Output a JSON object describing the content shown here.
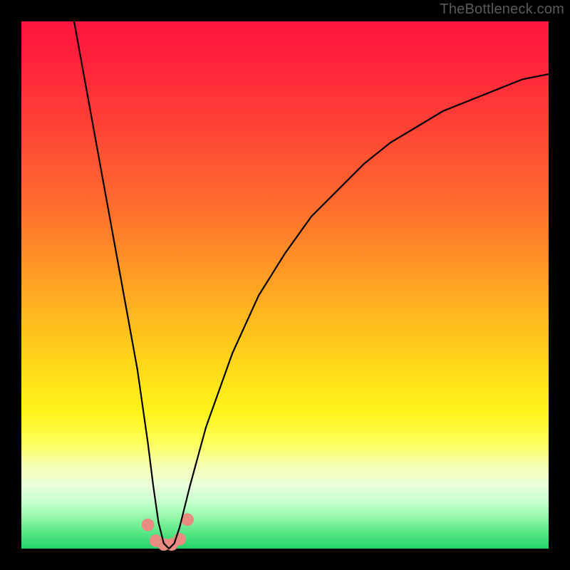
{
  "watermark": "TheBottleneck.com",
  "chart_data": {
    "type": "line",
    "title": "",
    "xlabel": "",
    "ylabel": "",
    "xlim": [
      0,
      100
    ],
    "ylim": [
      0,
      100
    ],
    "grid": false,
    "note": "No axis ticks or numeric labels are rendered; values are estimated from pixel positions on a 0–100 normalized axis.",
    "series": [
      {
        "name": "curve",
        "color": "#000000",
        "x": [
          10,
          12,
          14,
          16,
          18,
          20,
          22,
          24,
          25,
          26,
          27,
          28,
          29,
          30,
          32,
          35,
          40,
          45,
          50,
          55,
          60,
          65,
          70,
          75,
          80,
          85,
          90,
          95,
          100
        ],
        "y": [
          100,
          89,
          78,
          67,
          56,
          45,
          34,
          20,
          12,
          5,
          1,
          0,
          1,
          4,
          12,
          23,
          37,
          48,
          56,
          63,
          68,
          73,
          77,
          80,
          83,
          85,
          87,
          89,
          90
        ]
      }
    ],
    "markers": {
      "name": "bottom-cluster",
      "color": "#e98b81",
      "points": [
        {
          "x": 24.0,
          "y": 4.5
        },
        {
          "x": 25.5,
          "y": 1.5
        },
        {
          "x": 27.0,
          "y": 0.8
        },
        {
          "x": 28.5,
          "y": 0.8
        },
        {
          "x": 30.0,
          "y": 1.8
        },
        {
          "x": 31.5,
          "y": 5.5
        }
      ],
      "radius_pct": 1.2
    },
    "background_gradient": {
      "stops": [
        {
          "pct": 0,
          "color": "#ff153e"
        },
        {
          "pct": 20,
          "color": "#ff4236"
        },
        {
          "pct": 46,
          "color": "#ff9326"
        },
        {
          "pct": 66,
          "color": "#ffdb19"
        },
        {
          "pct": 84,
          "color": "#f6ffb0"
        },
        {
          "pct": 100,
          "color": "#22d36a"
        }
      ]
    }
  }
}
